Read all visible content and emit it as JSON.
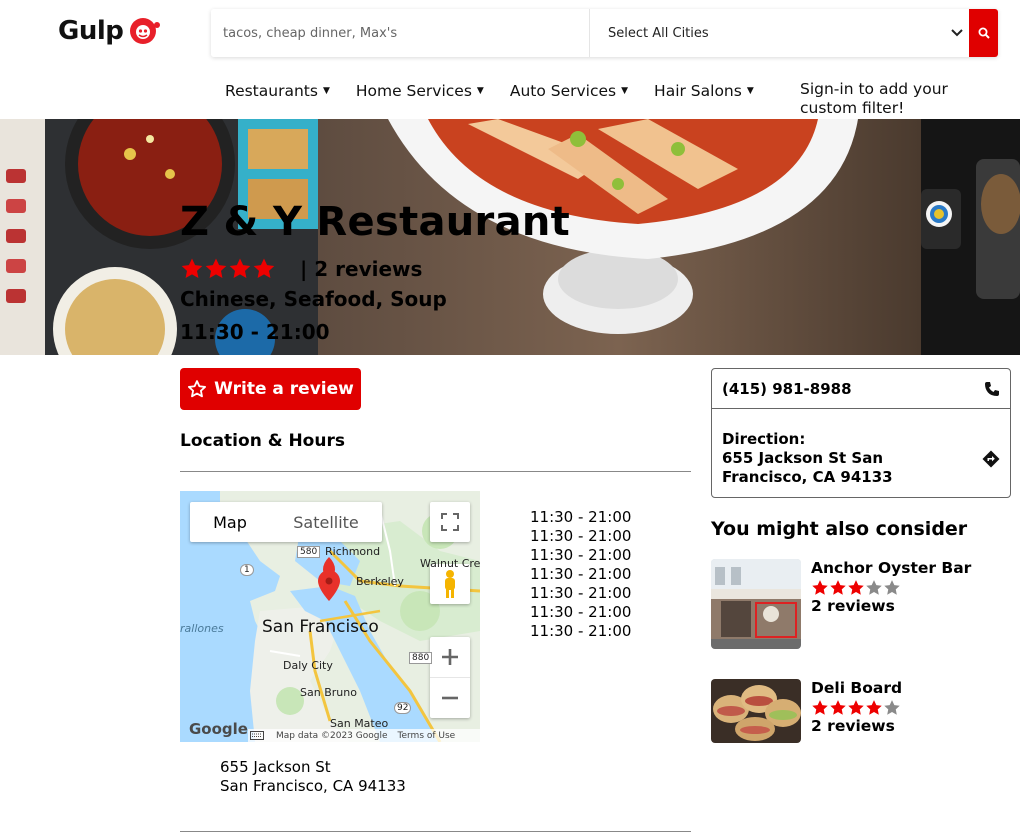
{
  "header": {
    "logo_text": "Gulp",
    "search_placeholder": "tacos, cheap dinner, Max's",
    "city_select": "Select All Cities",
    "nav": [
      {
        "label": "Restaurants"
      },
      {
        "label": "Home Services"
      },
      {
        "label": "Auto Services"
      },
      {
        "label": "Hair Salons"
      }
    ],
    "signin_text": "Sign-in to add your custom filter!"
  },
  "restaurant": {
    "name": "Z & Y Restaurant",
    "rating": 4,
    "reviews_text": "| 2 reviews",
    "categories": "Chinese, Seafood, Soup",
    "hours": "11:30 - 21:00"
  },
  "actions": {
    "write_review": "Write a review"
  },
  "location": {
    "title": "Location & Hours",
    "map": {
      "tab_map": "Map",
      "tab_satellite": "Satellite",
      "labels": {
        "richmond": "Richmond",
        "berkeley": "Berkeley",
        "walnut_creek": "Walnut Cre",
        "san_francisco": "San Francisco",
        "daly_city": "Daly City",
        "san_bruno": "San Bruno",
        "san_mateo": "San Mateo",
        "farallones": "rallones",
        "hw580": "580",
        "hw880": "880",
        "hw1": "1",
        "hw92": "92"
      },
      "google": "Google",
      "map_data": "Map data ©2023 Google",
      "terms": "Terms of Use"
    },
    "hours_list": [
      "11:30 - 21:00",
      "11:30 - 21:00",
      "11:30 - 21:00",
      "11:30 - 21:00",
      "11:30 - 21:00",
      "11:30 - 21:00",
      "11:30 - 21:00"
    ],
    "address_line1": "655 Jackson St",
    "address_line2": "San Francisco, CA 94133"
  },
  "contact": {
    "phone": "(415) 981-8988",
    "direction_label": "Direction:",
    "direction_address": "655 Jackson St San Francisco, CA 94133"
  },
  "consider": {
    "title": "You might also consider",
    "items": [
      {
        "name": "Anchor Oyster Bar",
        "rating": 3,
        "reviews": "2 reviews"
      },
      {
        "name": "Deli Board",
        "rating": 4,
        "reviews": "2 reviews"
      }
    ]
  },
  "colors": {
    "accent": "#e00000",
    "star_on": "#ee0000",
    "star_off": "#8a8a8a"
  }
}
